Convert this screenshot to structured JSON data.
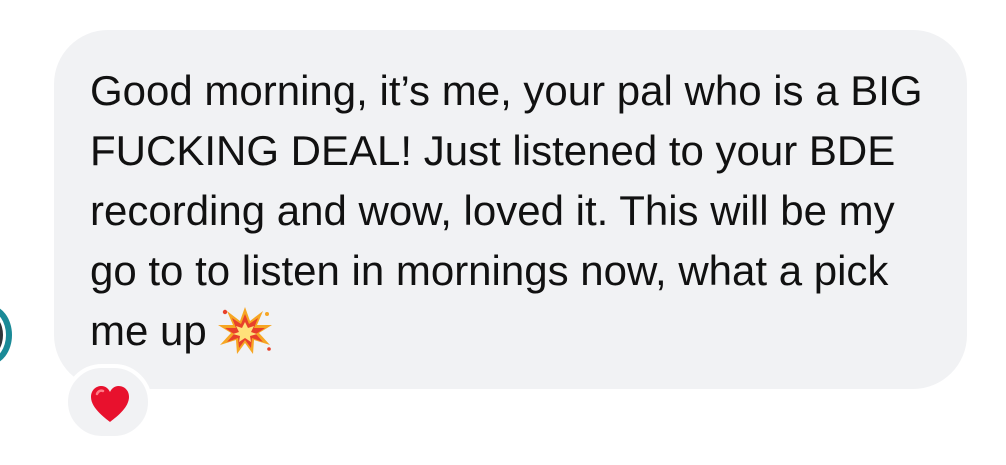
{
  "message": {
    "text": "Good morning, it’s me, your pal who is a BIG FUCKING DEAL! Just listened to your BDE recording and wow, loved it. This will be my go to to listen in mornings now, what a pick me up",
    "trailing_emoji": "collision-emoji"
  },
  "reaction": {
    "emoji": "red-heart-icon"
  },
  "colors": {
    "bubble_background": "#f1f2f4",
    "text": "#111111",
    "avatar_ring": "#1a8a97",
    "heart": "#e8112d"
  }
}
